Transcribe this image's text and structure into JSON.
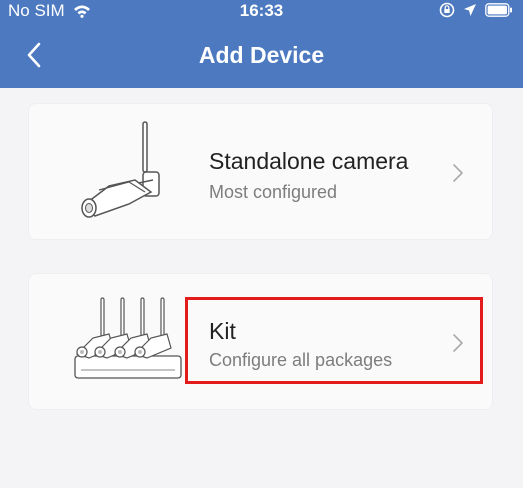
{
  "status_bar": {
    "carrier": "No SIM",
    "time": "16:33",
    "icons": [
      "wifi-icon",
      "orientation-lock-icon",
      "location-arrow-icon",
      "battery-icon"
    ]
  },
  "header": {
    "title": "Add Device",
    "back_icon": "chevron-left-icon"
  },
  "options": [
    {
      "title": "Standalone camera",
      "subtitle": "Most configured",
      "icon": "camera-illustration"
    },
    {
      "title": "Kit",
      "subtitle": "Configure all packages",
      "icon": "kit-illustration",
      "highlighted": true
    }
  ],
  "colors": {
    "header_bg": "#4d79c0",
    "page_bg": "#f4f4f6",
    "highlight": "#e31b1b",
    "subtitle": "#7d7d7d"
  }
}
